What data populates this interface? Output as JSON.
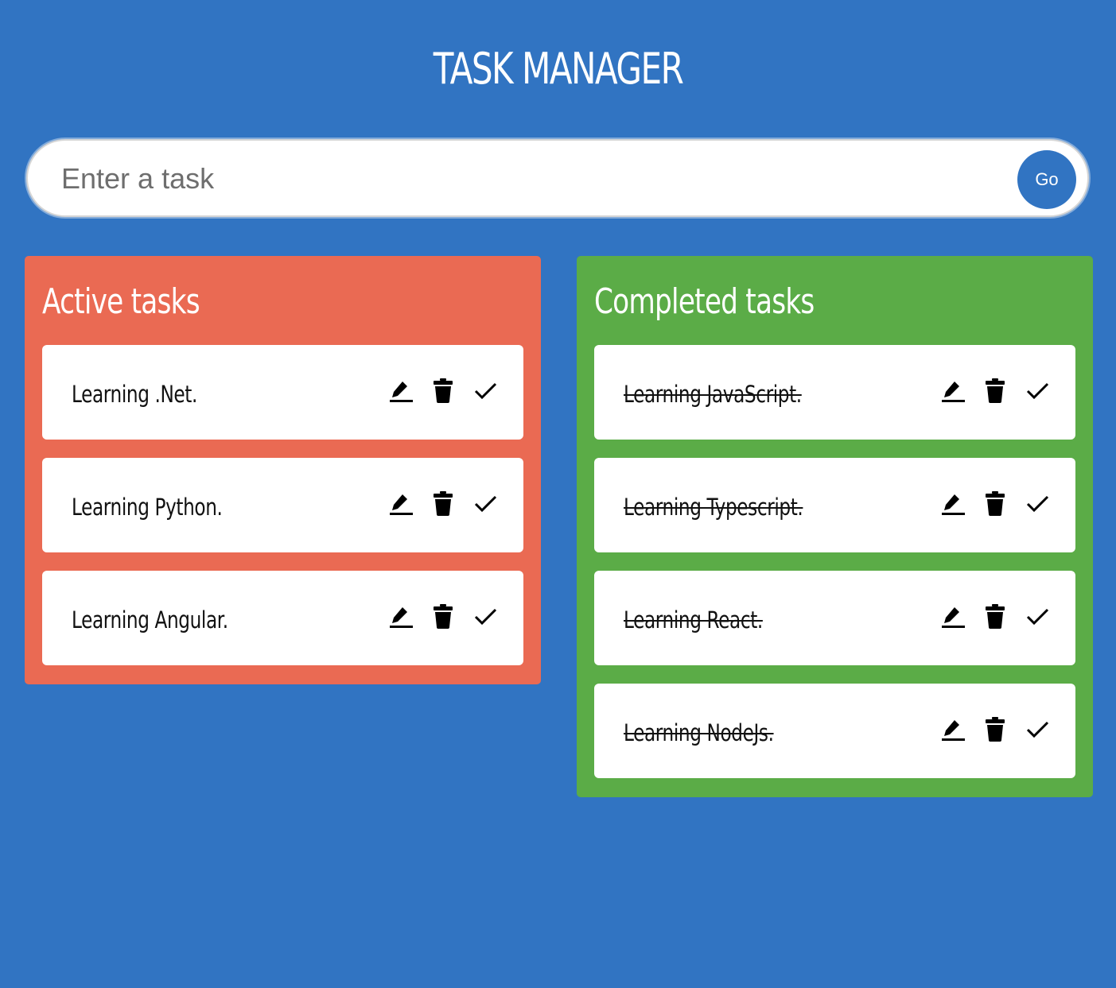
{
  "header": {
    "title": "TASK MANAGER"
  },
  "search": {
    "placeholder": "Enter a task",
    "value": "",
    "button_label": "Go"
  },
  "colors": {
    "background": "#3174c2",
    "active_panel": "#ea6a53",
    "completed_panel": "#5bac47",
    "card": "#ffffff"
  },
  "active": {
    "title": "Active tasks",
    "tasks": [
      {
        "label": "Learning .Net."
      },
      {
        "label": "Learning Python."
      },
      {
        "label": "Learning Angular."
      }
    ]
  },
  "completed": {
    "title": "Completed tasks",
    "tasks": [
      {
        "label": "Learning JavaScript."
      },
      {
        "label": "Learning Typescript."
      },
      {
        "label": "Learning React."
      },
      {
        "label": "Learning NodeJs."
      }
    ]
  },
  "icons": {
    "edit": "pencil-icon",
    "delete": "trash-icon",
    "complete": "check-icon"
  }
}
